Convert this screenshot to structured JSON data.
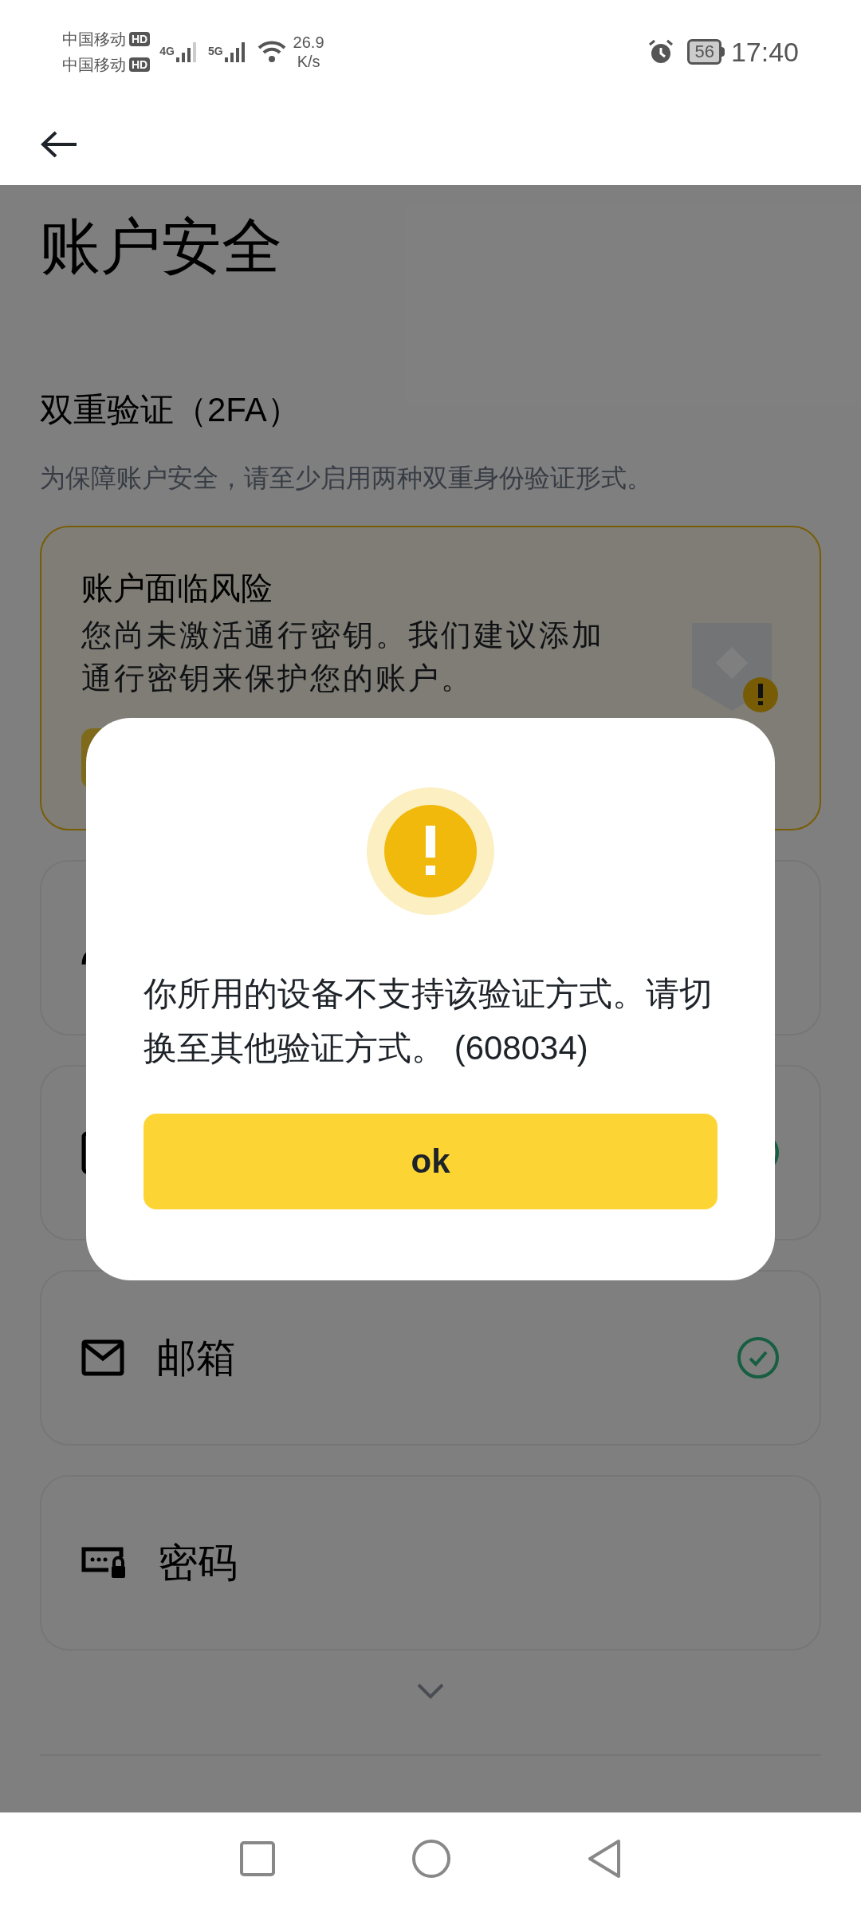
{
  "status_bar": {
    "carriers": [
      "中国移动",
      "中国移动"
    ],
    "hd_badges": [
      "HD",
      "HD"
    ],
    "network_types": [
      "4G",
      "5G"
    ],
    "speed_value": "26.9",
    "speed_unit": "K/s",
    "battery": "56",
    "time": "17:40"
  },
  "page": {
    "title": "账户安全",
    "section_title": "双重验证（2FA）",
    "section_description": "为保障账户安全，请至少启用两种双重身份验证形式。"
  },
  "risk_card": {
    "title": "账户面临风险",
    "message": "您尚未激活通行密钥。我们建议添加通行密钥来保护您的账户。"
  },
  "methods": [
    {
      "kind": "passkey",
      "verified": false
    },
    {
      "kind": "device",
      "verified": true
    },
    {
      "kind": "email",
      "label": "邮箱",
      "verified": true
    },
    {
      "kind": "password",
      "label": "密码",
      "verified": false
    }
  ],
  "dialog": {
    "message": "你所用的设备不支持该验证方式。请切换至其他验证方式。 (608034)",
    "button": "ok"
  }
}
